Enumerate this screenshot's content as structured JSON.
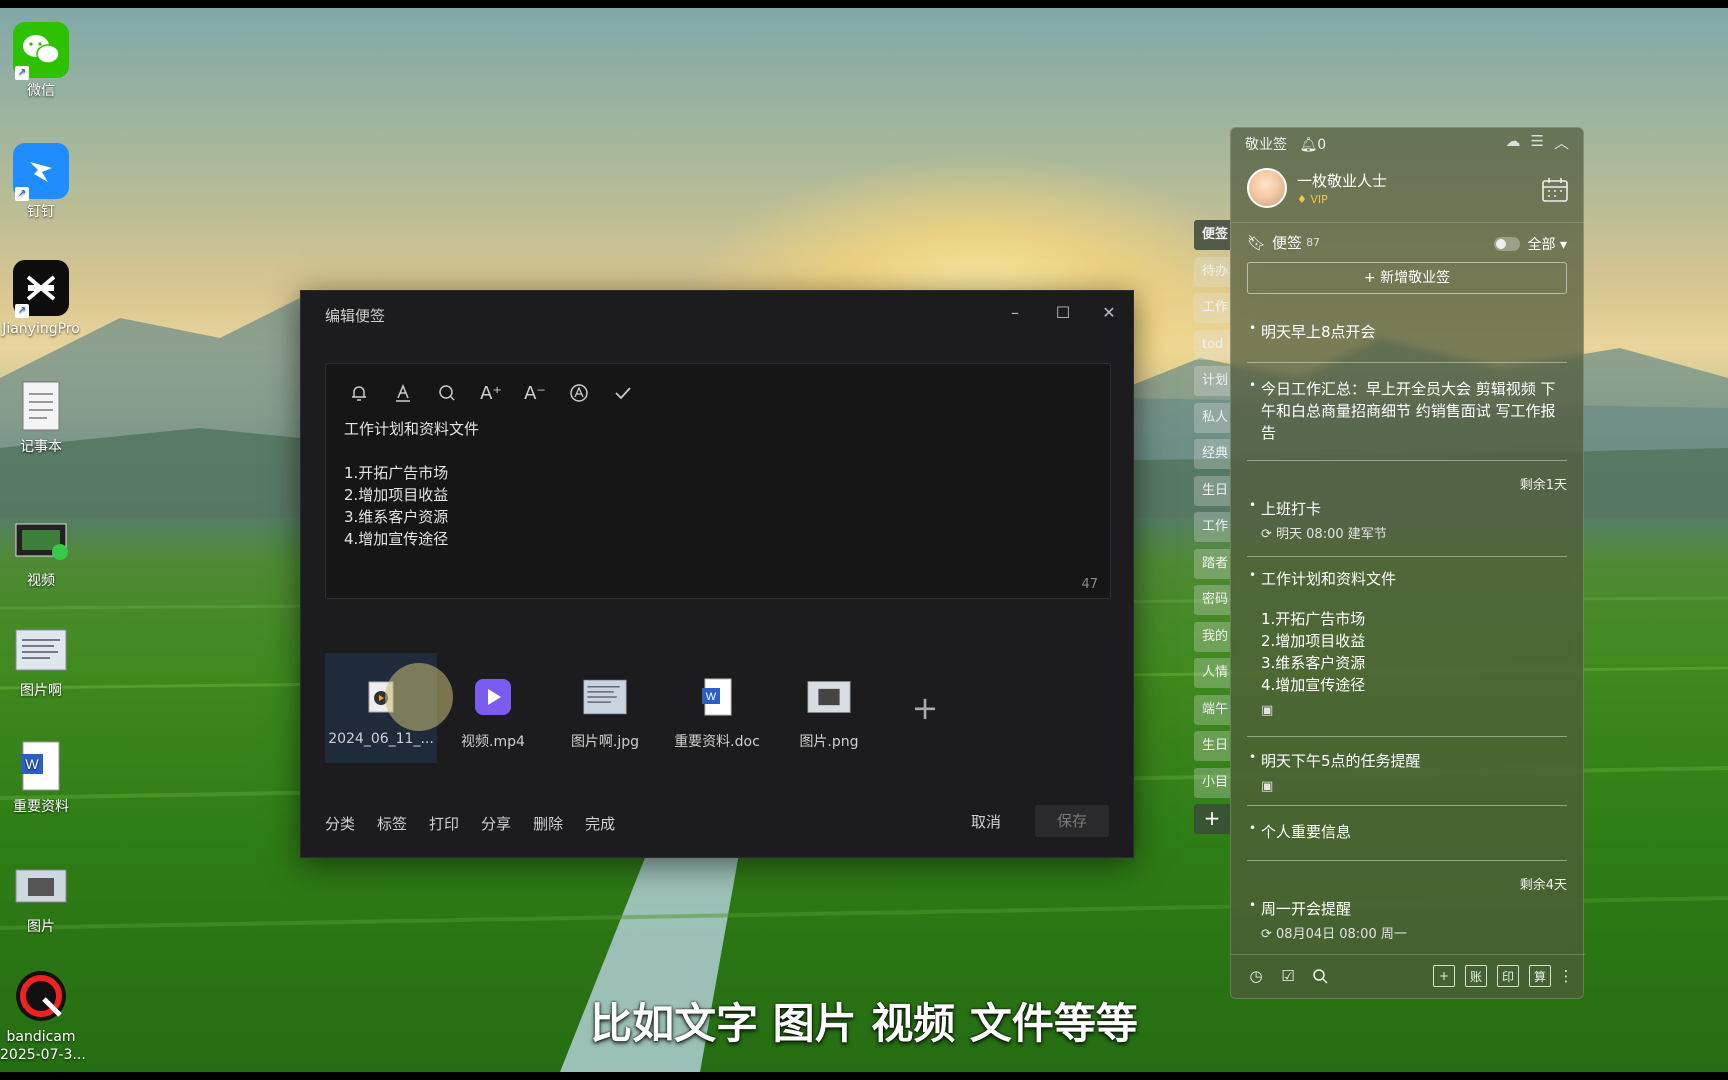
{
  "desktop_icons": [
    {
      "label": "微信",
      "icon": "wechat-icon"
    },
    {
      "label": "钉钉",
      "icon": "dingtalk-icon"
    },
    {
      "label": "JianyingPro",
      "icon": "jianying-icon"
    },
    {
      "label": "记事本",
      "icon": "notepad-icon"
    },
    {
      "label": "视频",
      "icon": "video-file-icon"
    },
    {
      "label": "图片啊",
      "icon": "image-file-icon"
    },
    {
      "label": "重要资料",
      "icon": "word-file-icon"
    },
    {
      "label": "图片",
      "icon": "image-file-icon"
    },
    {
      "label": "bandicam",
      "label2": "2025-07-3...",
      "icon": "bandicam-icon"
    }
  ],
  "editor": {
    "title": "编辑便签",
    "controls": {
      "minimize": "–",
      "maximize": "☐",
      "close": "✕"
    },
    "toolbar": [
      "bell-icon",
      "font-color-icon",
      "search-icon",
      "font-increase-icon",
      "font-decrease-icon",
      "format-icon",
      "check-icon"
    ],
    "toolbar_glyphs": {
      "font_increase": "A⁺",
      "font_decrease": "A⁻"
    },
    "content": "工作计划和资料文件\n\n1.开拓广告市场\n2.增加项目收益\n3.维系客户资源\n4.增加宣传途径",
    "char_count": "47",
    "attachments": [
      {
        "name": "2024_06_11_...",
        "icon": "video-thumb-icon",
        "selected": true
      },
      {
        "name": "视频.mp4",
        "icon": "play-icon"
      },
      {
        "name": "图片啊.jpg",
        "icon": "image-thumb-icon"
      },
      {
        "name": "重要资料.doc",
        "icon": "word-icon"
      },
      {
        "name": "图片.png",
        "icon": "image-thumb-icon"
      }
    ],
    "add_attachment": "+",
    "actions": [
      "分类",
      "标签",
      "打印",
      "分享",
      "删除",
      "完成"
    ],
    "cancel": "取消",
    "save": "保存"
  },
  "side_tabs": [
    "便签",
    "待办",
    "工作",
    "tod",
    "计划",
    "私人",
    "经典",
    "生日",
    "工作",
    "踏者",
    "密码",
    "我的",
    "人情",
    "端午",
    "生日",
    "小目"
  ],
  "side_tab_add": "+",
  "panel": {
    "app_name": "敬业签",
    "bell_count": "0",
    "user_name": "一枚敬业人士",
    "vip": "VIP",
    "list_title": "便签",
    "list_count": "87",
    "filter": "全部",
    "new_note": "+ 新增敬业签",
    "notes": [
      {
        "text": "明天早上8点开会"
      },
      {
        "text": "今日工作汇总：早上开全员大会 剪辑视频 下午和白总商量招商细节 约销售面试 写工作报告"
      },
      {
        "remain": "剩余1天",
        "text": "上班打卡",
        "sub": "明天 08:00 建军节"
      },
      {
        "text": "工作计划和资料文件",
        "body": "1.开拓广告市场\n2.增加项目收益\n3.维系客户资源\n4.增加宣传途径"
      },
      {
        "text": "明天下午5点的任务提醒"
      },
      {
        "text": "个人重要信息"
      },
      {
        "remain": "剩余4天",
        "text": "周一开会提醒",
        "sub": "08月04日 08:00 周一"
      }
    ],
    "footer_icons": [
      "clock-icon",
      "check-box-icon",
      "search-icon"
    ],
    "footer_boxes": [
      "+",
      "账",
      "印",
      "算"
    ],
    "footer_more": "⋮"
  },
  "subtitle": "比如文字 图片 视频 文件等等",
  "colors": {
    "accent_vip": "#f5c542",
    "editor_bg": "#1c1c1e",
    "panel_bg": "#505a3c"
  }
}
